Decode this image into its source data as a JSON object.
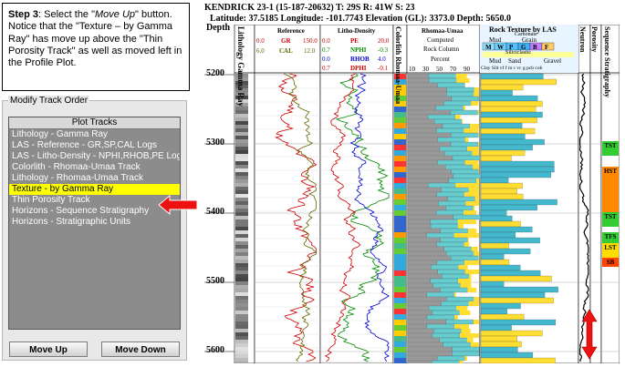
{
  "callout": {
    "step_label": "Step 3",
    "text_1": ": Select the \"",
    "move_up_italic": "Move Up",
    "text_2": "\" button. Notice that the \"Texture – by Gamma Ray\" has move up above the \"Thin Porosity Track\" as well as moved left in the Profile Plot."
  },
  "panel": {
    "title": "Modify Track Order",
    "list_header": "Plot Tracks",
    "items": [
      {
        "label": "Lithology - Gamma Ray",
        "selected": false
      },
      {
        "label": "LAS - Reference - GR,SP,CAL Logs",
        "selected": false
      },
      {
        "label": "LAS - Litho-Density - NPHI,RHOB,PE Logs",
        "selected": false
      },
      {
        "label": "Colorlith - Rhomaa-Umaa Track",
        "selected": false
      },
      {
        "label": "Lithology - Rhomaa-Umaa Track",
        "selected": false
      },
      {
        "label": "Texture - by Gamma Ray",
        "selected": true
      },
      {
        "label": "Thin Porosity Track",
        "selected": false
      },
      {
        "label": "Horizons - Sequence Stratigraphy",
        "selected": false
      },
      {
        "label": "Horizons - Stratigraphic Units",
        "selected": false
      }
    ],
    "move_up_label": "Move Up",
    "move_down_label": "Move Down"
  },
  "plot": {
    "header_line_1": "KENDRICK 23-1 (15-187-20632) T: 29S R: 41W S: 23",
    "header_line_2": "Latitude: 37.5185 Longitude: -101.7743 Elevation (GL): 3373.0 Depth: 5650.0",
    "depth_title": "Depth",
    "depths": [
      "5200",
      "5300",
      "5400",
      "5500",
      "5600"
    ],
    "track_lithology_gr": "Lithology Gamma Ray",
    "reference": {
      "title": "Reference",
      "gr_min": "0.0",
      "gr_name": "GR",
      "gr_max": "150.0",
      "cal_min": "6.0",
      "cal_name": "CAL",
      "cal_max": "12.0"
    },
    "litho_density": {
      "title": "Litho-Density",
      "rows": [
        {
          "min": "0.0",
          "name": "PE",
          "max": "20.0",
          "color": "#cc0000"
        },
        {
          "min": "0.7",
          "name": "NPHI",
          "max": "-0.3",
          "color": "#008800"
        },
        {
          "min": "0.0",
          "name": "RHOB",
          "max": "4.0",
          "color": "#0000cc"
        },
        {
          "min": "0.7",
          "name": "DPHI",
          "max": "-0.1",
          "color": "#cc0000"
        }
      ]
    },
    "colorlith_title": "Colorlith Rhomaa-Umaa",
    "rhomaa_umaa": {
      "title": "Rhomaa-Umaa",
      "line2": "Computed",
      "line3": "Rock Column",
      "line4": "Percent",
      "ticks": [
        "10",
        "30",
        "50",
        "70",
        "90"
      ]
    },
    "rock_texture": {
      "title": "Rock Texture by LAS",
      "carbonate": "Carbonate",
      "mud": "Mud",
      "grain": "Grain",
      "carb_cols": [
        "M",
        "W",
        "P",
        "G",
        "B",
        "F"
      ],
      "siliciclastic": "Siliciclastic",
      "sand": "Sand",
      "gravel": "Gravel",
      "cols": "Clay Silt vf f m c vc g pcb cob"
    },
    "neutron_title": "Neutron",
    "porosity_title": "Porosity",
    "sequence_title": "Sequence Stratigraphy",
    "seq_labels": [
      {
        "label": "TST",
        "color": "#33cc33"
      },
      {
        "label": "HST",
        "color": "#ff8800"
      },
      {
        "label": "TST",
        "color": "#33cc33"
      },
      {
        "label": "TFS",
        "color": "#33cc33"
      },
      {
        "label": "LST",
        "color": "#ffdd00"
      },
      {
        "label": "SB",
        "color": "#ff4400"
      }
    ]
  }
}
